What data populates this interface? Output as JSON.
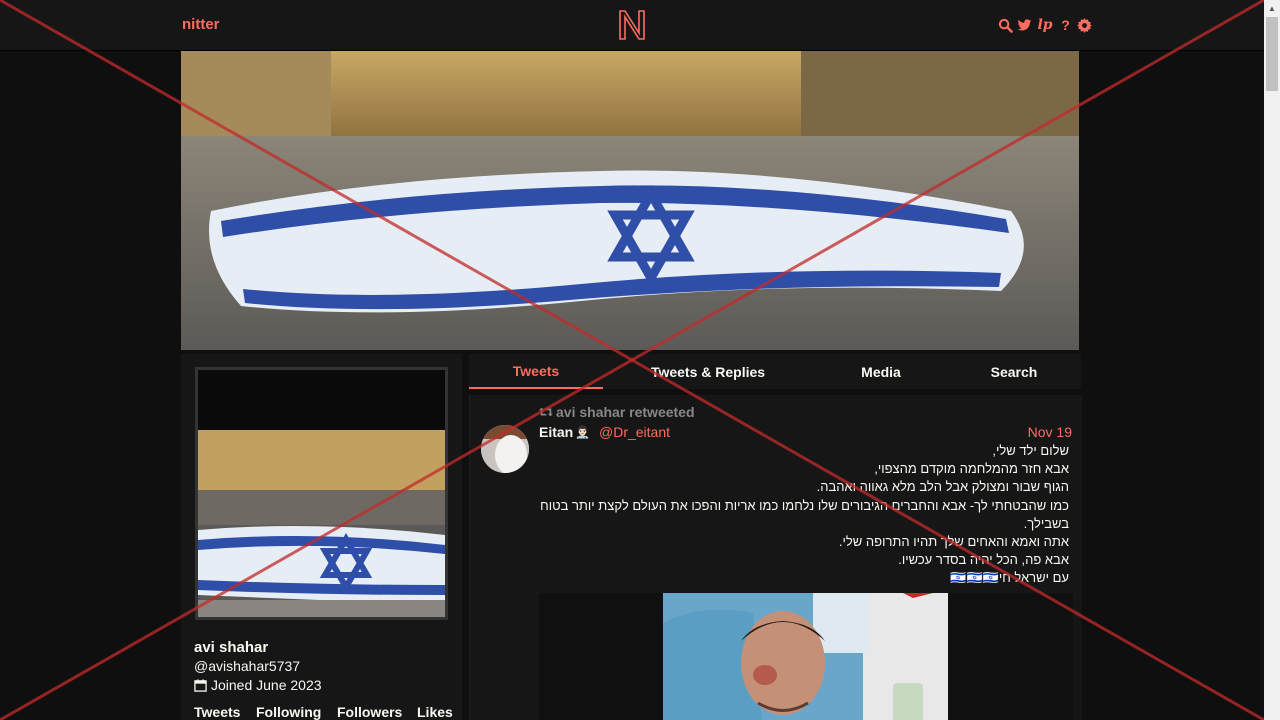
{
  "nav": {
    "brand": "nitter",
    "logo_letter": "N",
    "icons": [
      "search-icon",
      "twitter-bird-icon",
      "lp-icon",
      "help-icon",
      "gear-icon"
    ],
    "help_glyph": "?",
    "lp_glyph": "lp"
  },
  "profile": {
    "fullname": "avi shahar",
    "username": "@avishahar5737",
    "joined": "Joined June 2023",
    "stats": [
      "Tweets",
      "Following",
      "Followers",
      "Likes"
    ]
  },
  "tabs": [
    "Tweets",
    "Tweets & Replies",
    "Media",
    "Search"
  ],
  "active_tab": "Tweets",
  "tweet": {
    "retweet_header": "avi shahar retweeted",
    "fullname": "Eitan",
    "badge": "👨🏻‍⚕️",
    "username": "@Dr_eitant",
    "date": "Nov 19",
    "lines": [
      "שלום ילד שלי,",
      "אבא חזר מהמלחמה מוקדם מהצפוי,",
      "הגוף שבור ומצולק אבל הלב מלא גאווה ואהבה.",
      "כמו שהבטחתי לך- אבא והחברים הגיבורים שלו נלחמו כמו אריות והפכו את העולם לקצת יותר בטוח בשבילך.",
      "אתה ואמא והאחים שלך תהיו התרופה שלי.",
      "אבא פה, הכל יהיה בסדר עכשיו.",
      "עם ישראל חי🇮🇱🇮🇱🇮🇱"
    ]
  },
  "colors": {
    "accent": "#ff6c60",
    "background": "#0f0f0f",
    "panel": "#161616",
    "text": "#f8f8f2",
    "muted": "#888889",
    "overlay_x": "#c22a2a"
  }
}
